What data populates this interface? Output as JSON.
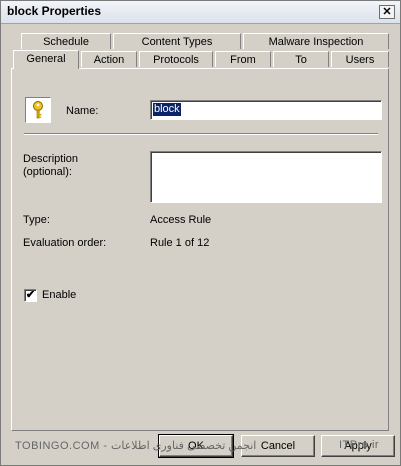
{
  "window": {
    "title": "block Properties",
    "close_glyph": "✕"
  },
  "tabs_row1": [
    "Schedule",
    "Content Types",
    "Malware Inspection"
  ],
  "tabs_row2": [
    "General",
    "Action",
    "Protocols",
    "From",
    "To",
    "Users"
  ],
  "active_tab": "General",
  "general": {
    "name_label": "Name:",
    "name_value": "block",
    "description_label_line1": "Description",
    "description_label_line2": "(optional):",
    "description_value": "",
    "type_label": "Type:",
    "type_value": "Access Rule",
    "order_label": "Evaluation order:",
    "order_value": "Rule 1 of 12",
    "enable_label": "Enable",
    "enable_checked": true,
    "check_glyph": "✔"
  },
  "buttons": {
    "ok": "OK",
    "cancel": "Cancel",
    "apply": "Apply"
  },
  "watermarks": {
    "left": "TOBINGO.COM - انجمن تخصصی فناوری اطلاعات",
    "right": "ITPro.ir"
  },
  "icons": {
    "key": "key-icon"
  }
}
